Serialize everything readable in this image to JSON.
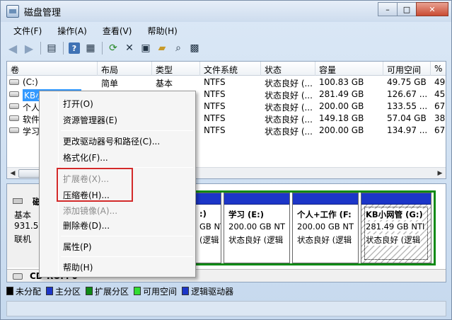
{
  "window": {
    "title": "磁盘管理"
  },
  "titlebar_buttons": {
    "minimize": "–",
    "maximize": "□",
    "close": "✕"
  },
  "menu": [
    "文件(F)",
    "操作(A)",
    "查看(V)",
    "帮助(H)"
  ],
  "toolbar_icons": [
    "back-arrow-icon",
    "forward-arrow-icon",
    "console-tree-icon",
    "help-icon",
    "properties-icon",
    "refresh-icon",
    "delete-icon",
    "properties-sheet-icon",
    "open-folder-icon",
    "search-icon",
    "disk-settings-icon"
  ],
  "columns": [
    "卷",
    "布局",
    "类型",
    "文件系统",
    "状态",
    "容量",
    "可用空间",
    "%"
  ],
  "volumes": [
    {
      "name": "(C:)",
      "layout": "简单",
      "type": "基本",
      "fs": "NTFS",
      "status": "状态良好 (...",
      "capacity": "100.83 GB",
      "free": "49.75 GB",
      "pct": "49"
    },
    {
      "name": "KB小网管 (G:)",
      "layout": "简单",
      "type": "基本",
      "fs": "NTFS",
      "status": "状态良好 (...",
      "capacity": "281.49 GB",
      "free": "126.67 ...",
      "pct": "45"
    },
    {
      "name": "个人",
      "layout": "",
      "type": "",
      "fs": "NTFS",
      "status": "状态良好 (...",
      "capacity": "200.00 GB",
      "free": "133.55 ...",
      "pct": "67"
    },
    {
      "name": "软件",
      "layout": "",
      "type": "",
      "fs": "NTFS",
      "status": "状态良好 (...",
      "capacity": "149.18 GB",
      "free": "57.04 GB",
      "pct": "38"
    },
    {
      "name": "学习",
      "layout": "",
      "type": "",
      "fs": "NTFS",
      "status": "状态良好 (...",
      "capacity": "200.00 GB",
      "free": "134.97 ...",
      "pct": "67"
    }
  ],
  "disk": {
    "name": "磁",
    "type": "基本",
    "size": "931.51",
    "state": "联机"
  },
  "partitions": [
    {
      "label": ":)",
      "line2": "GB NT",
      "line3": "(逻辑"
    },
    {
      "label": "学习  (E:)",
      "line2": "200.00 GB NT",
      "line3": "状态良好 (逻辑"
    },
    {
      "label": "个人+工作  (F:",
      "line2": "200.00 GB NT",
      "line3": "状态良好 (逻辑"
    },
    {
      "label": "KB小网管  (G:)",
      "line2": "281.49 GB NTI",
      "line3": "状态良好 (逻辑"
    }
  ],
  "cdrom": {
    "label": "CD-ROM 0"
  },
  "legend": [
    {
      "label": "未分配",
      "color": "#000000"
    },
    {
      "label": "主分区",
      "color": "#1c36c8"
    },
    {
      "label": "扩展分区",
      "color": "#0f8a16"
    },
    {
      "label": "可用空间",
      "color": "#33dd33"
    },
    {
      "label": "逻辑驱动器",
      "color": "#1c36c8"
    }
  ],
  "context_menu": {
    "open": "打开(O)",
    "explorer": "资源管理器(E)",
    "change_letter": "更改驱动器号和路径(C)...",
    "format": "格式化(F)...",
    "extend": "扩展卷(X)...",
    "shrink": "压缩卷(H)...",
    "mirror": "添加镜像(A)...",
    "delete": "删除卷(D)...",
    "properties": "属性(P)",
    "help": "帮助(H)"
  }
}
